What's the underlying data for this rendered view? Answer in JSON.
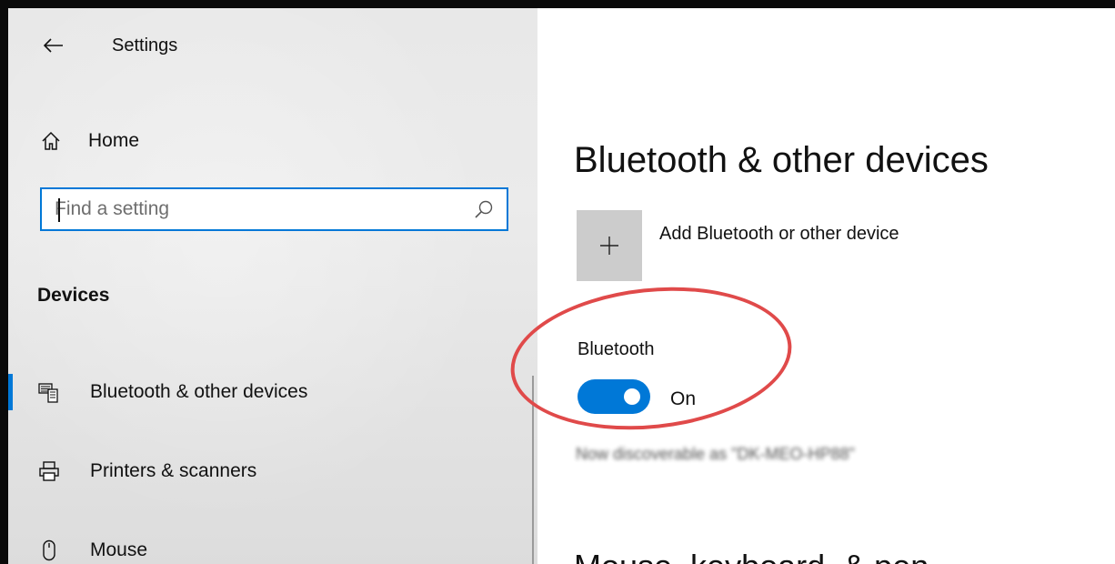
{
  "window": {
    "title": "Settings"
  },
  "sidebar": {
    "home_label": "Home",
    "search": {
      "placeholder": "Find a setting"
    },
    "section_title": "Devices",
    "items": [
      {
        "label": "Bluetooth & other devices",
        "icon": "bluetooth-devices-icon",
        "active": true
      },
      {
        "label": "Printers & scanners",
        "icon": "printer-icon",
        "active": false
      },
      {
        "label": "Mouse",
        "icon": "mouse-icon",
        "active": false
      }
    ]
  },
  "main": {
    "page_title": "Bluetooth & other devices",
    "add_device_label": "Add Bluetooth or other device",
    "bluetooth_heading": "Bluetooth",
    "toggle_state": "On",
    "discoverable_text": "Now discoverable as \"DK-MEO-HP88\"",
    "next_section_title": "Mouse, keyboard, & pen"
  },
  "colors": {
    "accent": "#0078d7",
    "annotation": "#e04a4a"
  }
}
